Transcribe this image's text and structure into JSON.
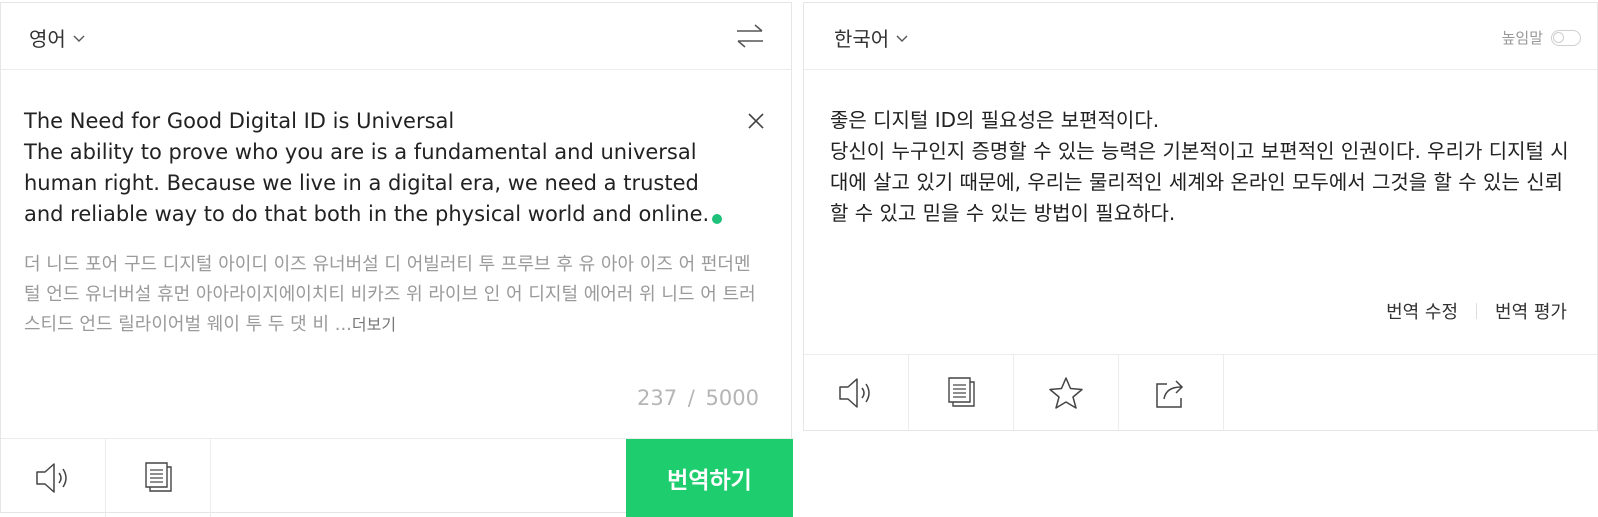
{
  "source": {
    "language": "영어",
    "text": "The Need for Good Digital ID is Universal\nThe ability to prove who you are is a fundamental and universal human right. Because we live in a digital era, we need a trusted and reliable way to do that both in the physical world and online.",
    "pronunciation": "더 니드 포어 구드 디지털 아이디 이즈 유너버설 디 어빌러티 투 프루브 후 유 아아 이즈 어 펀더멘털 언드 유너버설 휴먼 아아라이지에이치티 비카즈 위 라이브 인 어 디지털 에어러 위 니드 어 트러스티드 언드 릴라이어벌 웨이 투 두 댓 비 ...",
    "more_label": "더보기",
    "char_count": "237",
    "char_separator": "/",
    "char_limit": "5000",
    "translate_button": "번역하기"
  },
  "target": {
    "language": "한국어",
    "honorific_label": "높임말",
    "honorific_on": false,
    "text": "좋은 디지털 ID의 필요성은 보편적이다.\n당신이 누구인지 증명할 수 있는 능력은 기본적이고 보편적인 인권이다. 우리가 디지털 시대에 살고 있기 때문에, 우리는 물리적인 세계와 온라인 모두에서 그것을 할 수 있는 신뢰할 수 있고 믿을 수 있는 방법이 필요하다.",
    "edit_label": "번역 수정",
    "rate_label": "번역 평가"
  },
  "icons": [
    "chevron-down-icon",
    "swap-icon",
    "close-icon",
    "speaker-icon",
    "copy-icon",
    "star-icon",
    "share-icon"
  ],
  "colors": {
    "accent": "#1ecd6e",
    "caret": "#1ec07a"
  }
}
